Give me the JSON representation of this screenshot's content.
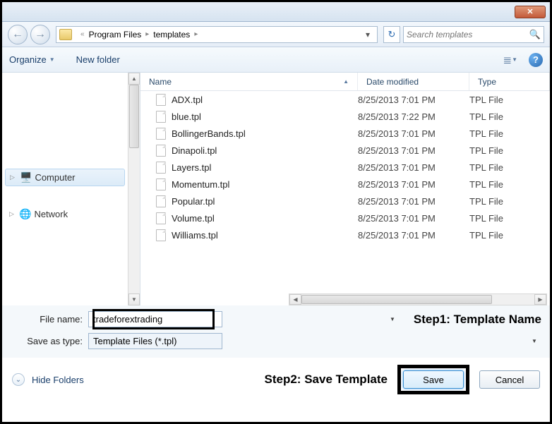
{
  "titlebar": {
    "close": "✕"
  },
  "nav": {
    "back": "←",
    "forward": "→",
    "crumb_sep": "«",
    "crumb1": "Program Files",
    "crumb2": "templates",
    "sep_glyph": "▸",
    "refresh": "↻",
    "search_placeholder": "Search templates",
    "search_icon": "🔍"
  },
  "toolbar": {
    "organize": "Organize",
    "newfolder": "New folder",
    "view_icon": "☰",
    "help": "?"
  },
  "tree": {
    "computer": "Computer",
    "network": "Network"
  },
  "columns": {
    "name": "Name",
    "date": "Date modified",
    "type": "Type"
  },
  "files": [
    {
      "name": "ADX.tpl",
      "date": "8/25/2013 7:01 PM",
      "type": "TPL File"
    },
    {
      "name": "blue.tpl",
      "date": "8/25/2013 7:22 PM",
      "type": "TPL File"
    },
    {
      "name": "BollingerBands.tpl",
      "date": "8/25/2013 7:01 PM",
      "type": "TPL File"
    },
    {
      "name": "Dinapoli.tpl",
      "date": "8/25/2013 7:01 PM",
      "type": "TPL File"
    },
    {
      "name": "Layers.tpl",
      "date": "8/25/2013 7:01 PM",
      "type": "TPL File"
    },
    {
      "name": "Momentum.tpl",
      "date": "8/25/2013 7:01 PM",
      "type": "TPL File"
    },
    {
      "name": "Popular.tpl",
      "date": "8/25/2013 7:01 PM",
      "type": "TPL File"
    },
    {
      "name": "Volume.tpl",
      "date": "8/25/2013 7:01 PM",
      "type": "TPL File"
    },
    {
      "name": "Williams.tpl",
      "date": "8/25/2013 7:01 PM",
      "type": "TPL File"
    }
  ],
  "form": {
    "filename_label": "File name:",
    "filename_value": "tradeforextrading",
    "saveas_label": "Save as type:",
    "saveas_value": "Template Files (*.tpl)"
  },
  "annotations": {
    "step1": "Step1: Template Name",
    "step2": "Step2: Save Template"
  },
  "bottom": {
    "hide": "Hide Folders",
    "save": "Save",
    "cancel": "Cancel"
  }
}
